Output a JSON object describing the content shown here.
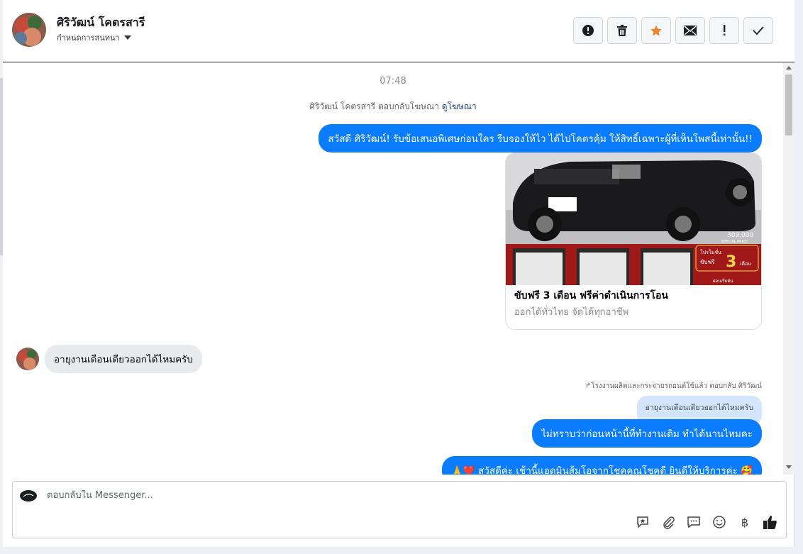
{
  "header": {
    "contact_name": "ศิริวัฒน์ โคตรสารี",
    "assign_label": "กำหนดการสนทนา",
    "toolbar": [
      {
        "name": "spam-button",
        "icon": "alert-circle-icon"
      },
      {
        "name": "delete-button",
        "icon": "trash-icon"
      },
      {
        "name": "star-button",
        "icon": "star-icon",
        "color": "#f5822a"
      },
      {
        "name": "mark-unread-button",
        "icon": "envelope-icon"
      },
      {
        "name": "follow-up-button",
        "icon": "exclamation-icon"
      },
      {
        "name": "mark-done-button",
        "icon": "check-icon"
      }
    ]
  },
  "thread": {
    "timestamp": "07:48",
    "ad_note_prefix": "ศิริวัฒน์ โคตรสารี ตอบกลับโฆษณา",
    "ad_note_link": "ดูโฆษณา",
    "messages": [
      {
        "direction": "out",
        "text": "สวัสดี ศิริวัฒน์! รับข้อเสนอพิเศษก่อนใคร รีบจองให้ไว ได้ไปโคตรคุ้ม ให้สิทธิ์เฉพาะผู้ที่เห็นโพสนี้เท่านั้น!!"
      },
      {
        "direction": "in",
        "text": "อายุงานเดือนเดียวออกได้ไหมครับ"
      },
      {
        "direction": "out",
        "text": "ไม่ทราบว่าก่อนหน้านี้ที่ทำงานเดิม ทำได้นานไหมคะ"
      },
      {
        "direction": "out",
        "text": "🙏❤️ สวัสดีค่ะ เช้านี้แอดมินส้มโอจากโชคคูณโชคดี ยินดีให้บริการค่ะ 🥰"
      }
    ],
    "ad_card": {
      "title": "ขับฟรี 3 เดือน ฟรีค่าดำเนินการโอน",
      "subtitle": "ออกได้ทั่วไทย จัดได้ทุกอาชีพ",
      "price_text": "309,000",
      "price_label": "SPECIAL PRICE",
      "promo_small": "โปรโมชั่น",
      "promo_free": "ขับฟรี",
      "promo_num": "3",
      "promo_month": "เดือน",
      "promo_tag": "ผ่อนเริ่มต้น"
    },
    "reply_meta": "↱โรงงานผลิตและกระจายรถยนต์ใช้แล้ว ตอบกลับ ศิริวัฒน์",
    "reply_quote": "อายุงานเดือนเดียวออกได้ไหมครับ"
  },
  "composer": {
    "placeholder": "ตอบกลับใน Messenger...",
    "tools": [
      "saved-reply-icon",
      "attachment-icon",
      "chat-bubble-icon",
      "emoji-icon",
      "baht-icon",
      "like-icon"
    ],
    "baht_symbol": "฿"
  },
  "colors": {
    "outgoing_bubble": "#0a7cff",
    "incoming_bubble": "#e9eaed",
    "star": "#f5822a"
  }
}
